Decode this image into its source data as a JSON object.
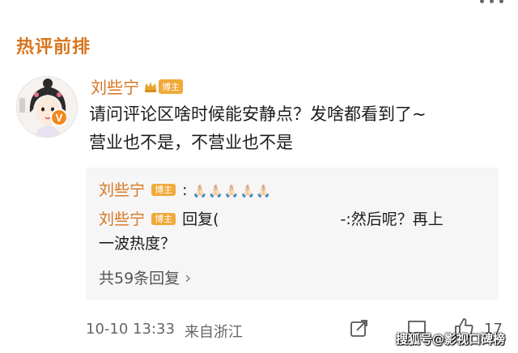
{
  "section": {
    "title": "热评前排"
  },
  "comment": {
    "author": "刘些宁",
    "badge": "博主",
    "text_line1": "请问评论区啥时候能安静点？发啥都看到了~",
    "text_line2": "营业也不是，不营业也不是",
    "verified_mark": "V"
  },
  "replies": [
    {
      "author": "刘些宁",
      "badge": "博主",
      "sep": ":",
      "content": "🙏🏻🙏🏻🙏🏻🙏🏻🙏🏻"
    },
    {
      "author": "刘些宁",
      "badge": "博主",
      "prefix": "回复(",
      "suffix": "-:然后呢？再上",
      "line2": "一波热度？"
    }
  ],
  "reply_count": {
    "label": "共59条回复",
    "chevron": "›"
  },
  "footer": {
    "date": "10-10 13:33",
    "location": "来自浙江",
    "likes": "17"
  },
  "icons": [
    "more-icon",
    "share-icon",
    "comment-icon",
    "like-icon",
    "verified-icon",
    "crown-icon"
  ],
  "colors": {
    "accent": "#d8751f",
    "badge": "#f1a93a",
    "reply_bg": "#f6f6f6"
  },
  "watermark": "搜狐号@影视口碑榜"
}
